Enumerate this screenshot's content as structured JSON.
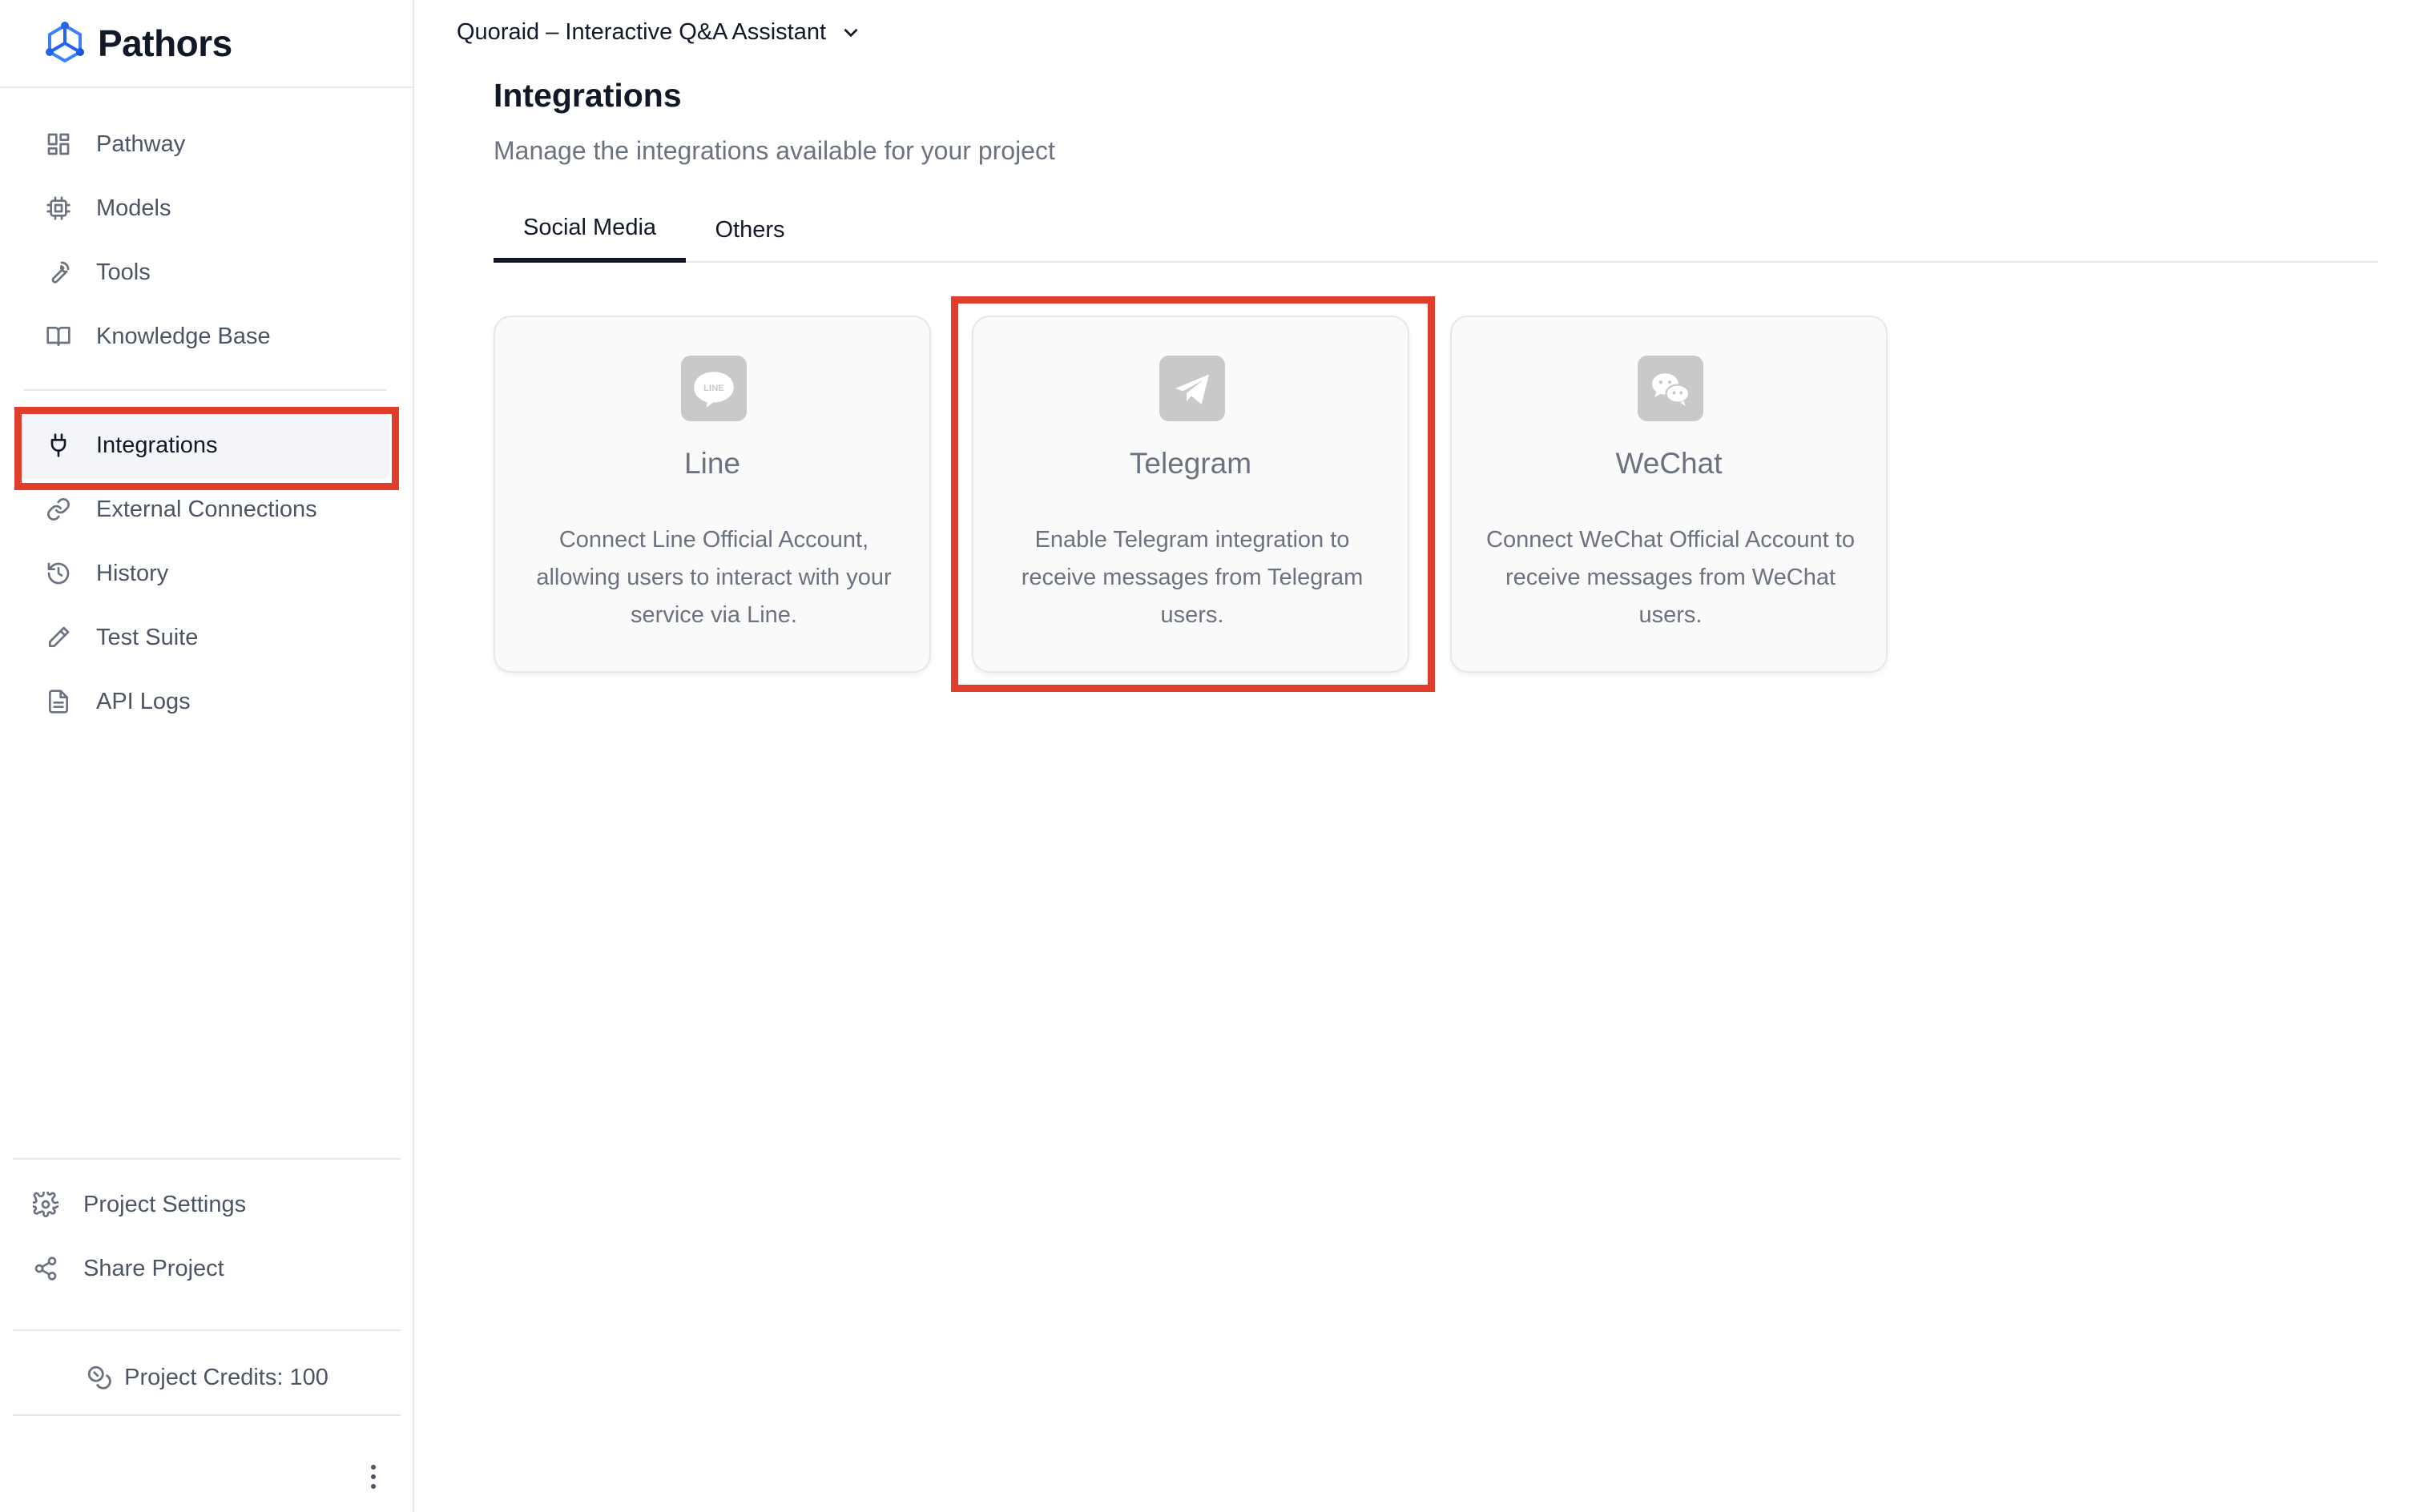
{
  "app": {
    "name": "Pathors"
  },
  "sidebar": {
    "items": [
      {
        "label": "Pathway",
        "icon": "grid-icon"
      },
      {
        "label": "Models",
        "icon": "chip-icon"
      },
      {
        "label": "Tools",
        "icon": "wrench-icon"
      },
      {
        "label": "Knowledge Base",
        "icon": "book-icon"
      },
      {
        "label": "Integrations",
        "icon": "plug-icon",
        "active": true
      },
      {
        "label": "External Connections",
        "icon": "link-icon"
      },
      {
        "label": "History",
        "icon": "history-icon"
      },
      {
        "label": "Test Suite",
        "icon": "pencil-icon"
      },
      {
        "label": "API Logs",
        "icon": "document-icon"
      }
    ],
    "bottom_items": [
      {
        "label": "Project Settings",
        "icon": "gear-icon"
      },
      {
        "label": "Share Project",
        "icon": "share-icon"
      }
    ],
    "credits": "Project Credits: 100"
  },
  "header": {
    "project_name": "Quoraid – Interactive Q&A Assistant"
  },
  "page": {
    "title": "Integrations",
    "subtitle": "Manage the integrations available for your project"
  },
  "tabs": [
    {
      "label": "Social Media",
      "active": true
    },
    {
      "label": "Others",
      "active": false
    }
  ],
  "cards": [
    {
      "name": "Line",
      "icon": "line-icon",
      "description": "Connect Line Official Account, allowing users to interact with your service via Line."
    },
    {
      "name": "Telegram",
      "icon": "telegram-icon",
      "description": "Enable Telegram integration to receive messages from Telegram users."
    },
    {
      "name": "WeChat",
      "icon": "wechat-icon",
      "description": "Connect WeChat Official Account to receive messages from WeChat users."
    }
  ],
  "colors": {
    "highlight": "#e03e2d",
    "brand": "#2563eb",
    "active_bg": "#f3f5f9"
  }
}
